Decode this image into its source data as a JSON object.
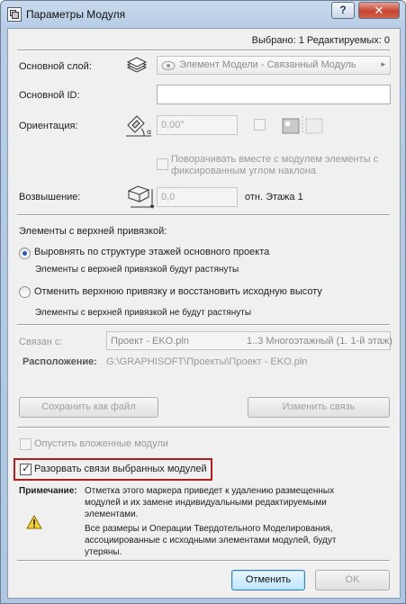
{
  "window": {
    "title": "Параметры Модуля",
    "help_label": "?",
    "close_label": "✕"
  },
  "header": {
    "selection_info": "Выбрано: 1 Редактируемых: 0"
  },
  "main_layer": {
    "label": "Основной слой:",
    "value": "Элемент Модели - Связанный Модуль"
  },
  "main_id": {
    "label": "Основной ID:",
    "value": ""
  },
  "orientation": {
    "label": "Ориентация:",
    "value": "0,00°",
    "rotate_label_line1": "Поворачивать вместе с модулем элементы с",
    "rotate_label_line2": "фиксированным углом наклона"
  },
  "elevation": {
    "label": "Возвышение:",
    "value": "0,0",
    "suffix": "отн. Этажа 1"
  },
  "top_link": {
    "heading": "Элементы с верхней привязкой:",
    "option1": "Выровнять по структуре этажей основного проекта",
    "option1_note": "Элементы с верхней привязкой будут растянуты",
    "option2": "Отменить верхнюю привязку и восстановить исходную высоту",
    "option2_note": "Элементы с верхней привязкой не будут растянуты"
  },
  "linked": {
    "label": "Связан с:",
    "file": "Проект - EKO.pln",
    "story": "1..3 Многоэтажный (1. 1-й этаж)",
    "location_label": "Расположение:",
    "location_value": "G:\\GRAPHISOFT\\Проекты\\Проект - EKO.pln"
  },
  "buttons": {
    "save_as_file": "Сохранить как файл",
    "change_link": "Изменить связь",
    "cancel": "Отменить",
    "ok": "OK"
  },
  "options": {
    "skip_nested": "Опустить вложенные модули",
    "break_links": "Разорвать связи выбранных модулей"
  },
  "note": {
    "label": "Примечание:",
    "line1": "Отметка этого маркера приведет к удалению размещенных",
    "line2": "модулей и их замене индивидуальными редактируемыми",
    "line3": "элементами.",
    "line4": "Все размеры и Операции Твердотельного Моделирования,",
    "line5": "ассоциированные с исходными элементами модулей, будут",
    "line6": "утеряны."
  },
  "colors": {
    "highlight": "#b01e1e",
    "accent": "#2a5db7"
  }
}
